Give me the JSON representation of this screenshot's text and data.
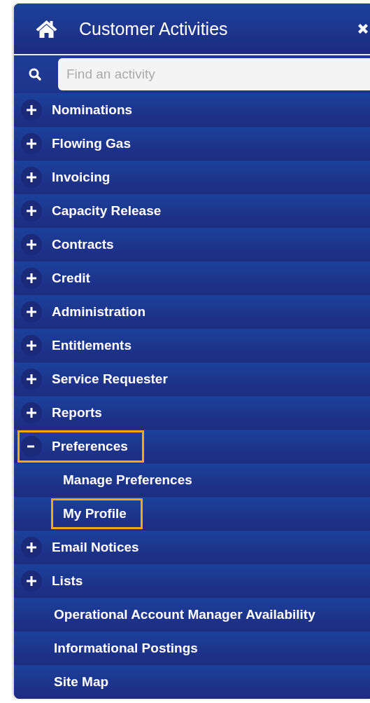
{
  "panel": {
    "title": "Customer Activities"
  },
  "search": {
    "placeholder": "Find an activity"
  },
  "items": [
    {
      "kind": "group",
      "label": "Nominations",
      "expanded": false,
      "highlighted": false
    },
    {
      "kind": "group",
      "label": "Flowing Gas",
      "expanded": false,
      "highlighted": false
    },
    {
      "kind": "group",
      "label": "Invoicing",
      "expanded": false,
      "highlighted": false
    },
    {
      "kind": "group",
      "label": "Capacity Release",
      "expanded": false,
      "highlighted": false
    },
    {
      "kind": "group",
      "label": "Contracts",
      "expanded": false,
      "highlighted": false
    },
    {
      "kind": "group",
      "label": "Credit",
      "expanded": false,
      "highlighted": false
    },
    {
      "kind": "group",
      "label": "Administration",
      "expanded": false,
      "highlighted": false
    },
    {
      "kind": "group",
      "label": "Entitlements",
      "expanded": false,
      "highlighted": false
    },
    {
      "kind": "group",
      "label": "Service Requester",
      "expanded": false,
      "highlighted": false
    },
    {
      "kind": "group",
      "label": "Reports",
      "expanded": false,
      "highlighted": false
    },
    {
      "kind": "group",
      "label": "Preferences",
      "expanded": true,
      "highlighted": true,
      "children": [
        {
          "label": "Manage Preferences",
          "highlighted": false
        },
        {
          "label": "My Profile",
          "highlighted": true
        }
      ]
    },
    {
      "kind": "group",
      "label": "Email Notices",
      "expanded": false,
      "highlighted": false
    },
    {
      "kind": "group",
      "label": "Lists",
      "expanded": false,
      "highlighted": false
    },
    {
      "kind": "link",
      "label": "Operational Account Manager Availability",
      "highlighted": false
    },
    {
      "kind": "link",
      "label": "Informational Postings",
      "highlighted": false
    },
    {
      "kind": "link",
      "label": "Site Map",
      "highlighted": false
    }
  ]
}
